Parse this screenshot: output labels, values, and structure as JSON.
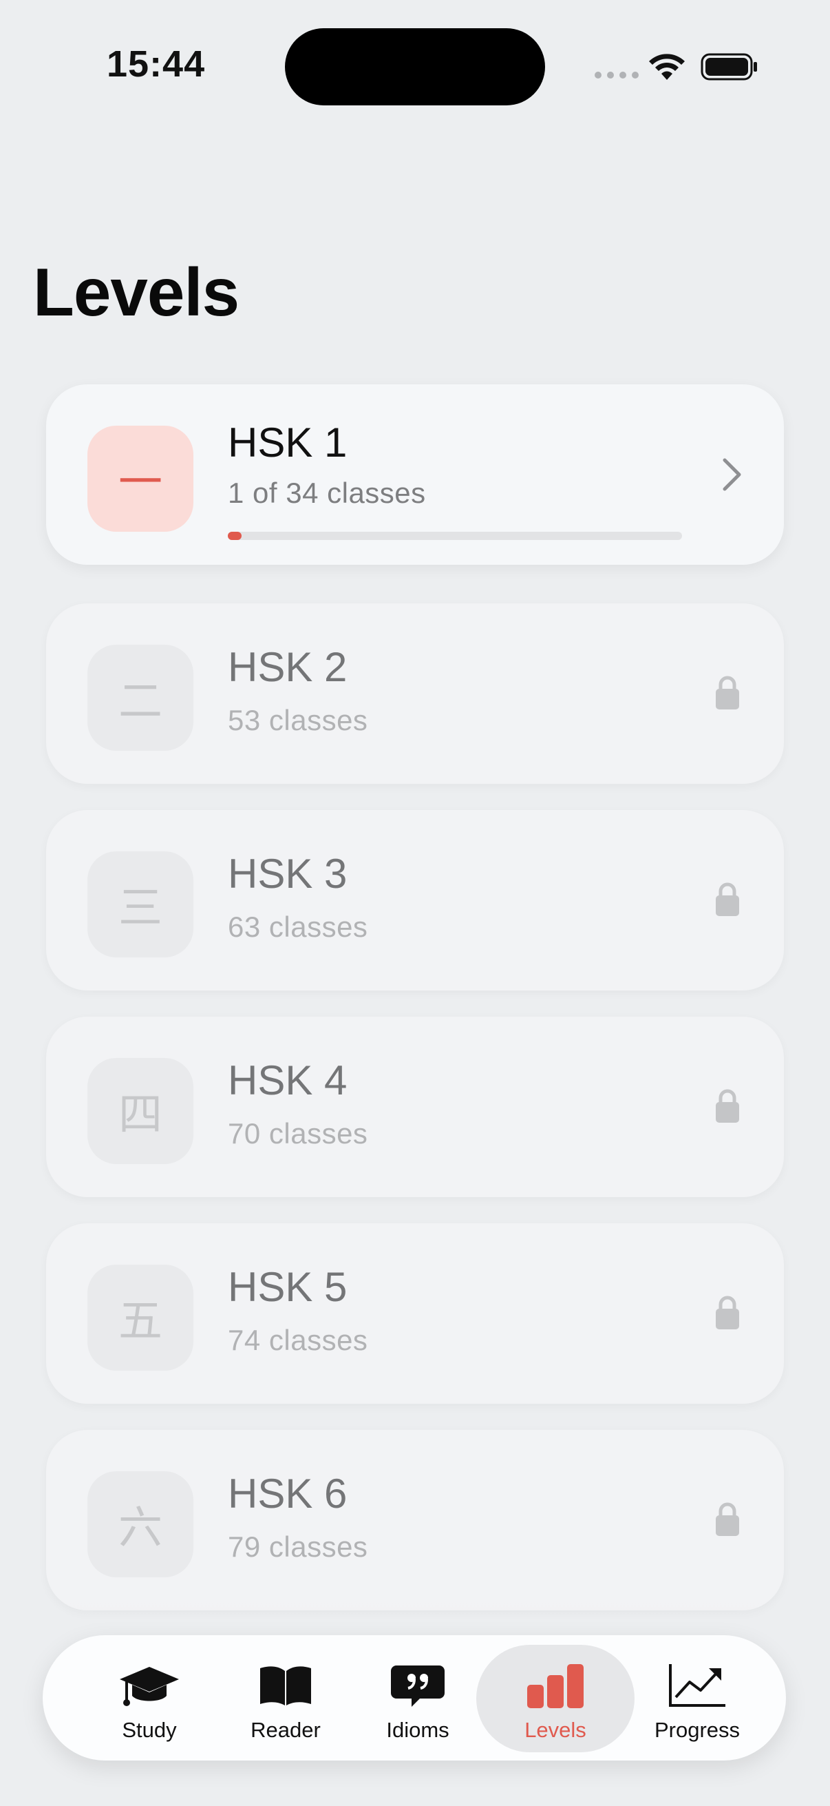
{
  "status_bar": {
    "time": "15:44"
  },
  "header": {
    "title": "Levels"
  },
  "levels": [
    {
      "title": "HSK 1",
      "subtitle": "1 of 34 classes",
      "glyph": "一",
      "state": "unlocked",
      "progress": 0.03,
      "icon": "chevron-right-icon"
    },
    {
      "title": "HSK 2",
      "subtitle": "53 classes",
      "glyph": "二",
      "state": "locked",
      "icon": "lock-icon"
    },
    {
      "title": "HSK 3",
      "subtitle": "63 classes",
      "glyph": "三",
      "state": "locked",
      "icon": "lock-icon"
    },
    {
      "title": "HSK 4",
      "subtitle": "70 classes",
      "glyph": "四",
      "state": "locked",
      "icon": "lock-icon"
    },
    {
      "title": "HSK 5",
      "subtitle": "74 classes",
      "glyph": "五",
      "state": "locked",
      "icon": "lock-icon"
    },
    {
      "title": "HSK 6",
      "subtitle": "79 classes",
      "glyph": "六",
      "state": "locked",
      "icon": "lock-icon"
    }
  ],
  "tabs": [
    {
      "label": "Study",
      "icon": "graduation-cap-icon",
      "selected": false
    },
    {
      "label": "Reader",
      "icon": "book-icon",
      "selected": false
    },
    {
      "label": "Idioms",
      "icon": "quote-bubble-icon",
      "selected": false
    },
    {
      "label": "Levels",
      "icon": "bar-chart-icon",
      "selected": true
    },
    {
      "label": "Progress",
      "icon": "trend-chart-icon",
      "selected": false
    }
  ],
  "colors": {
    "accent": "#e05a4e",
    "accent_soft": "#fbdcd8",
    "background": "#eceef0",
    "card": "#f2f3f5"
  }
}
